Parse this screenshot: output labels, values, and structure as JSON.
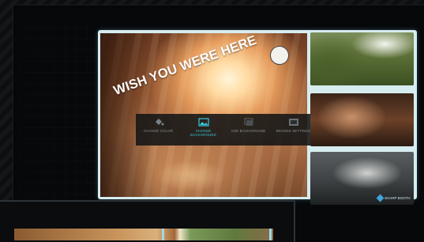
{
  "editor": {
    "overlay_caption": "WISH YOU WERE HERE",
    "toolbar": [
      {
        "label": "CHANGE COLOR",
        "icon": "paint-bucket-icon",
        "active": false
      },
      {
        "label": "CHANGE BACKGROUND",
        "icon": "image-icon",
        "active": true
      },
      {
        "label": "ADD BACKGROUND",
        "icon": "layers-icon",
        "active": false
      },
      {
        "label": "BRANDS SETTINGS",
        "icon": "photo-frame-icon",
        "active": false
      }
    ]
  },
  "thumbnails": [
    {
      "name": "jungle-thumbnail"
    },
    {
      "name": "room-thumbnail"
    },
    {
      "name": "grey-scene-thumbnail"
    }
  ],
  "brand": {
    "name": "SHARP BOOTH"
  },
  "colors": {
    "active": "#38c8de",
    "frame": "#d6ecef",
    "background": "#0b0d0f"
  }
}
